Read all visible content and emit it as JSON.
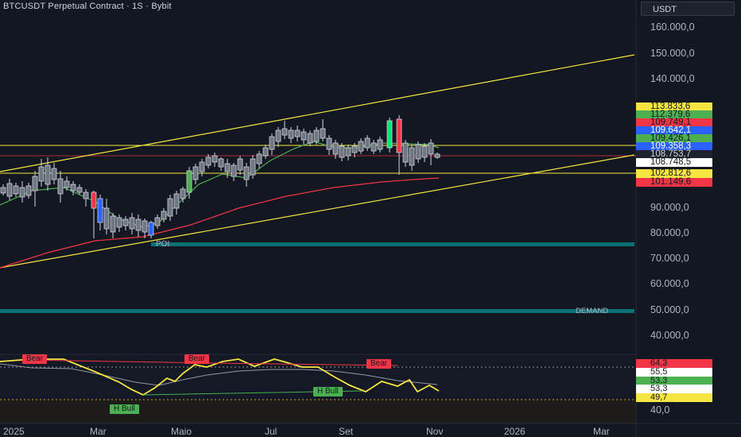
{
  "header": {
    "title": "BTCUSDT Perpetual Contract · 1S · Bybit",
    "currency_button": "USDT"
  },
  "price_axis": [
    "160.000,0",
    "150.000,0",
    "140.000,0",
    "90.000,0",
    "80.000,0",
    "70.000,0",
    "60.000,0",
    "50.000,0",
    "40.000,0"
  ],
  "price_tags": [
    {
      "text": "113.833,6",
      "bg": "#f5e642",
      "fg": "#131722"
    },
    {
      "text": "112.379,6",
      "bg": "#4caf50",
      "fg": "#131722"
    },
    {
      "text": "109.749,1",
      "bg": "#f23645",
      "fg": "#131722"
    },
    {
      "text": "109.642,1",
      "bg": "#2962ff",
      "fg": "#ffffff"
    },
    {
      "text": "109.426,1",
      "bg": "#4caf50",
      "fg": "#131722"
    },
    {
      "text": "109.358,3",
      "bg": "#2962ff",
      "fg": "#ffffff"
    },
    {
      "text": "108.753,7",
      "bg": "#1e222d",
      "fg": "#d1d4dc"
    },
    {
      "text": "108.748,5",
      "bg": "#ffffff",
      "fg": "#131722"
    },
    {
      "text": "102.812,6",
      "bg": "#f5e642",
      "fg": "#131722"
    },
    {
      "text": "101.149,6",
      "bg": "#f23645",
      "fg": "#131722"
    }
  ],
  "rsi_tags": [
    {
      "text": "64,3",
      "bg": "#f23645",
      "fg": "#131722"
    },
    {
      "text": "55,5",
      "bg": "#ffffff",
      "fg": "#131722"
    },
    {
      "text": "53,3",
      "bg": "#4caf50",
      "fg": "#131722"
    },
    {
      "text": "53,3",
      "bg": "#ffffff",
      "fg": "#131722"
    },
    {
      "text": "49,7",
      "bg": "#f5e642",
      "fg": "#131722"
    }
  ],
  "rsi_axis": "40,0",
  "x_axis": [
    "2025",
    "Mar",
    "Maio",
    "Jul",
    "Set",
    "Nov",
    "2026",
    "Mar"
  ],
  "zones": {
    "poi": "POI",
    "demand": "DEMAND"
  },
  "rsi_labels": [
    {
      "text": "Bear",
      "kind": "bear"
    },
    {
      "text": "Bear",
      "kind": "bear"
    },
    {
      "text": "Bear",
      "kind": "bear"
    },
    {
      "text": "H Bull",
      "kind": "bull"
    },
    {
      "text": "H Bull",
      "kind": "bull"
    }
  ],
  "colors": {
    "background": "#131722",
    "bull": "#4caf50",
    "bear": "#f23645",
    "channel": "#f5e642",
    "zone": "#0d6e73"
  }
}
